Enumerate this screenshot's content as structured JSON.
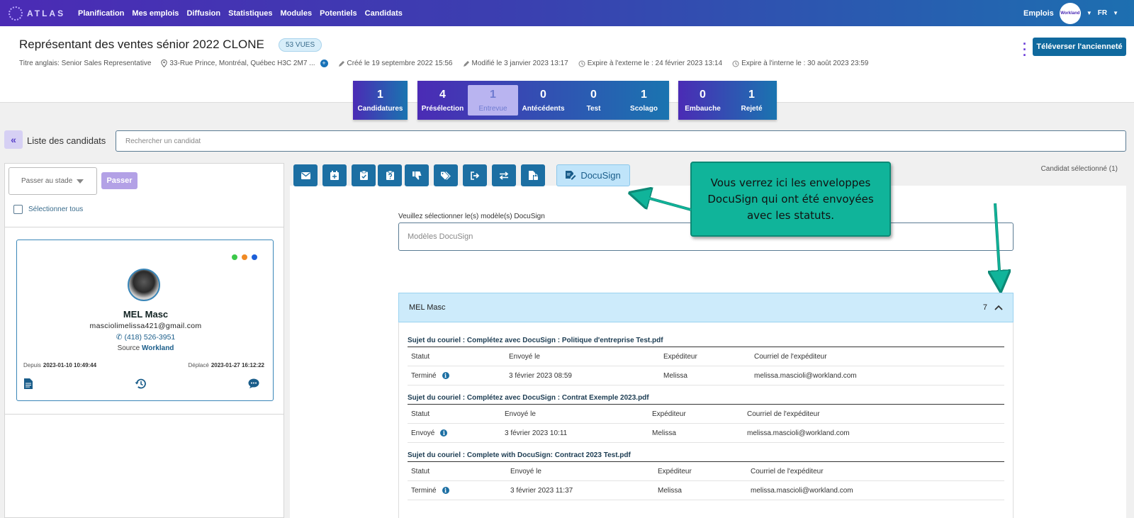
{
  "nav": {
    "logo_text": "ATLAS",
    "items": [
      "Planification",
      "Mes emplois",
      "Diffusion",
      "Statistiques",
      "Modules",
      "Potentiels",
      "Candidats"
    ],
    "right_label": "Emplois",
    "avatar_text": "Workland",
    "lang": "FR"
  },
  "job": {
    "title": "Représentant des ventes sénior 2022 CLONE",
    "views": "53 VUES",
    "english_title": "Titre anglais: Senior Sales Representative",
    "address": "33-Rue Prince, Montréal, Québec H3C 2M7 ...",
    "created": "Créé le 19 septembre 2022 15:56",
    "modified": "Modifié le 3 janvier 2023 13:17",
    "expire_ext": "Expire à l'externe le : 24 février 2023 13:14",
    "expire_int": "Expire à l'interne le : 30 août 2023 23:59",
    "upload_btn": "Téléverser l'ancienneté"
  },
  "stages": {
    "group1": [
      {
        "n": "1",
        "label": "Candidatures"
      }
    ],
    "group2": [
      {
        "n": "4",
        "label": "Présélection"
      },
      {
        "n": "1",
        "label": "Entrevue"
      },
      {
        "n": "0",
        "label": "Antécédents"
      },
      {
        "n": "0",
        "label": "Test"
      },
      {
        "n": "1",
        "label": "Scolago"
      }
    ],
    "group3": [
      {
        "n": "0",
        "label": "Embauche"
      },
      {
        "n": "1",
        "label": "Rejeté"
      }
    ]
  },
  "list": {
    "label": "Liste des candidats",
    "search_placeholder": "Rechercher un candidat",
    "stage_select": "Passer au stade",
    "passer": "Passer",
    "select_all": "Sélectionner tous"
  },
  "candidate": {
    "name": "MEL Masc",
    "email": "masciolimelissa421@gmail.com",
    "phone": "(418) 526-3951",
    "source_label": "Source",
    "source": "Workland",
    "since_label": "Depuis",
    "since": "2023-01-10 10:49:44",
    "moved_label": "Déplacé",
    "moved": "2023-01-27 16:12:22",
    "dot_colors": [
      "#3cc84a",
      "#f08a24",
      "#1c5fd8"
    ]
  },
  "toolbar": {
    "icons": [
      "envelope-icon",
      "calendar-icon",
      "clipboard-check-icon",
      "clipboard-question-icon",
      "thumbs-down-icon",
      "tags-icon",
      "exit-icon",
      "swap-icon",
      "file-lock-icon"
    ],
    "docusign_label": "DocuSign",
    "selected_label": "Candidat sélectionné",
    "selected_count": "(1)"
  },
  "docusign": {
    "template_label": "Veuillez sélectionner le(s) modèle(s) DocuSign",
    "template_placeholder": "Modèles DocuSign",
    "envelope_owner": "MEL Masc",
    "envelope_count": "7",
    "columns": [
      "Statut",
      "Envoyé le",
      "Expéditeur",
      "Courriel de l'expéditeur"
    ],
    "envelopes": [
      {
        "subject": "Sujet du couriel : Complétez avec DocuSign : Politique d'entreprise Test.pdf",
        "status": "Terminé",
        "sent": "3 février 2023 08:59",
        "sender": "Melissa",
        "email": "melissa.mascioli@workland.com"
      },
      {
        "subject": "Sujet du couriel : Complétez avec DocuSign : Contrat Exemple 2023.pdf",
        "status": "Envoyé",
        "sent": "3 février 2023 10:11",
        "sender": "Melissa",
        "email": "melissa.mascioli@workland.com"
      },
      {
        "subject": "Sujet du couriel : Complete with DocuSign: Contract 2023 Test.pdf",
        "status": "Terminé",
        "sent": "3 février 2023 11:37",
        "sender": "Melissa",
        "email": "melissa.mascioli@workland.com"
      }
    ]
  },
  "callout": {
    "text": "Vous verrez ici les enveloppes DocuSign qui ont été envoyées avec les statuts."
  }
}
